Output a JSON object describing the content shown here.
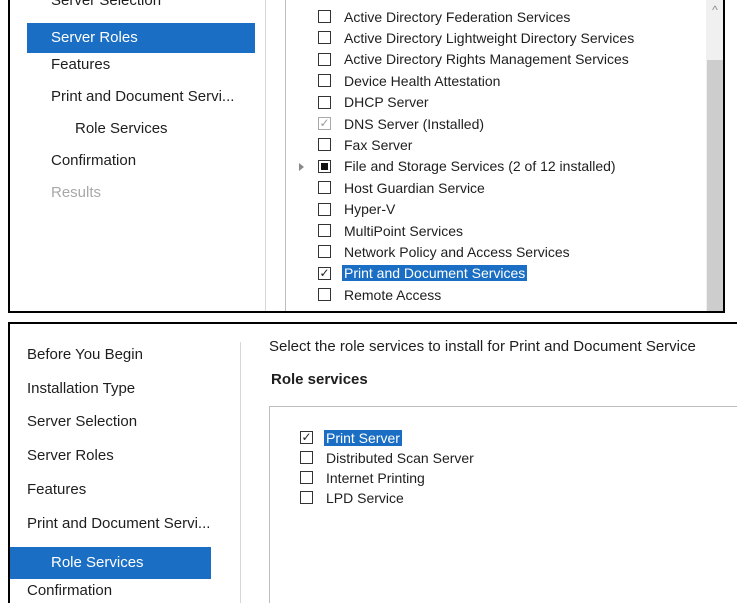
{
  "top": {
    "nav": [
      {
        "label": "Server Selection",
        "state": "normal",
        "indent": false
      },
      {
        "label": "Server Roles",
        "state": "selected",
        "indent": false
      },
      {
        "label": "Features",
        "state": "normal",
        "indent": false
      },
      {
        "label": "Print and Document Servi...",
        "state": "normal",
        "indent": false
      },
      {
        "label": "Role Services",
        "state": "normal",
        "indent": true
      },
      {
        "label": "Confirmation",
        "state": "normal",
        "indent": false
      },
      {
        "label": "Results",
        "state": "disabled",
        "indent": false
      }
    ],
    "roles": [
      {
        "label": "Active Directory Federation Services",
        "checked": false
      },
      {
        "label": "Active Directory Lightweight Directory Services",
        "checked": false
      },
      {
        "label": "Active Directory Rights Management Services",
        "checked": false
      },
      {
        "label": "Device Health Attestation",
        "checked": false
      },
      {
        "label": "DHCP Server",
        "checked": false
      },
      {
        "label": "DNS Server (Installed)",
        "checked": true,
        "disabled": true
      },
      {
        "label": "Fax Server",
        "checked": false
      },
      {
        "label": "File and Storage Services (2 of 12 installed)",
        "checked": "partial",
        "expandable": true
      },
      {
        "label": "Host Guardian Service",
        "checked": false
      },
      {
        "label": "Hyper-V",
        "checked": false
      },
      {
        "label": "MultiPoint Services",
        "checked": false
      },
      {
        "label": "Network Policy and Access Services",
        "checked": false
      },
      {
        "label": "Print and Document Services",
        "checked": true,
        "highlighted": true
      },
      {
        "label": "Remote Access",
        "checked": false
      }
    ],
    "scroll_up_glyph": "^"
  },
  "bottom": {
    "nav": [
      {
        "label": "Before You Begin",
        "state": "normal",
        "indent": false
      },
      {
        "label": "Installation Type",
        "state": "normal",
        "indent": false
      },
      {
        "label": "Server Selection",
        "state": "normal",
        "indent": false
      },
      {
        "label": "Server Roles",
        "state": "normal",
        "indent": false
      },
      {
        "label": "Features",
        "state": "normal",
        "indent": false
      },
      {
        "label": "Print and Document Servi...",
        "state": "normal",
        "indent": false
      },
      {
        "label": "Role Services",
        "state": "selected",
        "indent": true
      },
      {
        "label": "Confirmation",
        "state": "normal",
        "indent": false
      }
    ],
    "instruction": "Select the role services to install for Print and Document Service",
    "heading": "Role services",
    "services": [
      {
        "label": "Print Server",
        "checked": true,
        "highlighted": true
      },
      {
        "label": "Distributed Scan Server",
        "checked": false
      },
      {
        "label": "Internet Printing",
        "checked": false
      },
      {
        "label": "LPD Service",
        "checked": false
      }
    ]
  },
  "colors": {
    "accent": "#1a6ec3",
    "disabled_text": "#a8a8a8"
  }
}
